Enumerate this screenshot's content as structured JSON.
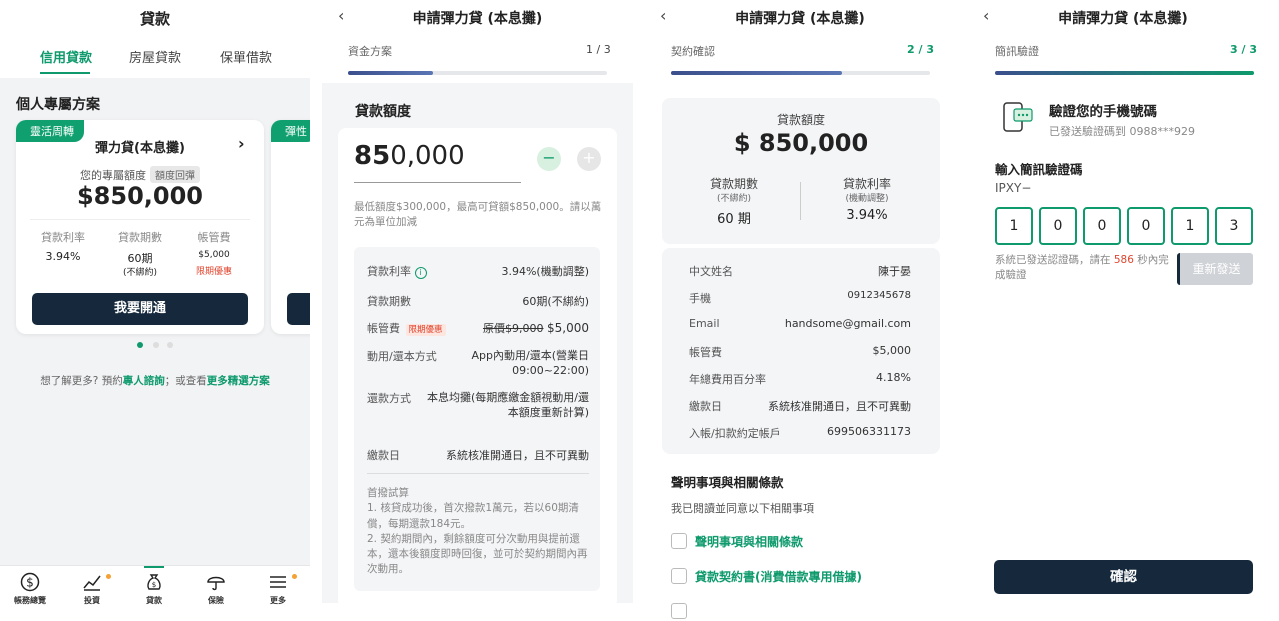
{
  "panel1": {
    "title": "貸款",
    "tabs": [
      "信用貸款",
      "房屋貸款",
      "保單借款"
    ],
    "section_title": "個人專屬方案",
    "card": {
      "ribbon": "靈活周轉",
      "name": "彈力貸(本息攤)",
      "amount_label": "您的專屬額度",
      "amount_pill": "額度回彈",
      "amount": "$850,000",
      "stats": [
        {
          "label": "貸款利率",
          "value": "3.94%",
          "sub": ""
        },
        {
          "label": "貸款期數",
          "value": "60期",
          "sub": "(不綁約)"
        },
        {
          "label": "帳管費",
          "value": "$5,000",
          "sub": "限期優惠"
        }
      ],
      "button": "我要開通"
    },
    "card2_ribbon": "彈性",
    "bottom_text_prefix": "想了解更多? 預約",
    "bottom_link1": "專人諮詢",
    "bottom_text_mid": "；或查看",
    "bottom_link2": "更多精選方案",
    "nav": [
      {
        "label": "帳務總覽",
        "icon": "dollar-icon"
      },
      {
        "label": "投資",
        "icon": "chart-icon"
      },
      {
        "label": "貸款",
        "icon": "moneybag-icon"
      },
      {
        "label": "保險",
        "icon": "umbrella-icon"
      },
      {
        "label": "更多",
        "icon": "menu-icon"
      }
    ]
  },
  "panel2": {
    "title": "申請彈力貸 (本息攤)",
    "step_label": "資金方案",
    "step": "1 / 3",
    "progress": 0.33,
    "section": "貸款額度",
    "amount_bold": "85",
    "amount_rest": "0,000",
    "hint": "最低額度$300,000，最高可貸額$850,000。請以萬元為單位加減",
    "rows": [
      {
        "label": "貸款利率",
        "value": "3.94%(機動調整)"
      },
      {
        "label": "貸款期數",
        "value": "60期(不綁約)"
      },
      {
        "label": "帳管費",
        "badge": "限期優惠",
        "strike": "原價$9,000",
        "value": "$5,000"
      },
      {
        "label": "動用/還本方式",
        "value": "App內動用/還本(營業日09:00~22:00)"
      },
      {
        "label": "還款方式",
        "value": "本息均攤(每期應繳金額視動用/還本額度重新計算)"
      },
      {
        "label": "繳款日",
        "value": "系統核准開通日，且不可異動"
      }
    ],
    "notes": "首撥試算\n1. 核貸成功後，首次撥款1萬元，若以60期清償，每期還款184元。\n2. 契約期間內，剩餘額度可分次動用與提前還本，還本後額度即時回復，並可於契約期間內再次動用。"
  },
  "panel3": {
    "title": "申請彈力貸 (本息攤)",
    "step_label": "契約確認",
    "step": "2 / 3",
    "progress": 0.66,
    "amount_label": "貸款額度",
    "amount": "$ 850,000",
    "term_label": "貸款期數",
    "term_sub": "(不綁約)",
    "term_value": "60 期",
    "rate_label": "貸款利率",
    "rate_sub": "(機動調整)",
    "rate_value": "3.94%",
    "info": [
      {
        "label": "中文姓名",
        "value": "陳于晏"
      },
      {
        "label": "手機",
        "value": "0912345678"
      },
      {
        "label": "Email",
        "value": "handsome@gmail.com"
      },
      {
        "label": "帳管費",
        "value": "$5,000"
      },
      {
        "label": "年總費用百分率",
        "value": "4.18%"
      },
      {
        "label": "繳款日",
        "value": "系統核准開通日，且不可異動"
      },
      {
        "label": "入帳/扣款約定帳戶",
        "value": "699506331173"
      }
    ],
    "terms_title": "聲明事項與相關條款",
    "terms_sub": "我已閱讀並同意以下相關事項",
    "checkboxes": [
      "聲明事項與相關條款",
      "貸款契約書(消費借款專用借據)"
    ]
  },
  "panel4": {
    "title": "申請彈力貸 (本息攤)",
    "step_label": "簡訊驗證",
    "step": "3 / 3",
    "progress": 1.0,
    "verify_title": "驗證您的手機號碼",
    "verify_sub": "已發送驗證碼到 0988***929",
    "input_label": "輸入簡訊驗證碼",
    "prefix": "IPXY−",
    "digits": [
      "1",
      "0",
      "0",
      "0",
      "1",
      "3"
    ],
    "countdown_prefix": "系統已發送認證碼，請在",
    "countdown": "586",
    "countdown_suffix": "秒內完成驗證",
    "resend": "重新發送",
    "confirm": "確認"
  }
}
